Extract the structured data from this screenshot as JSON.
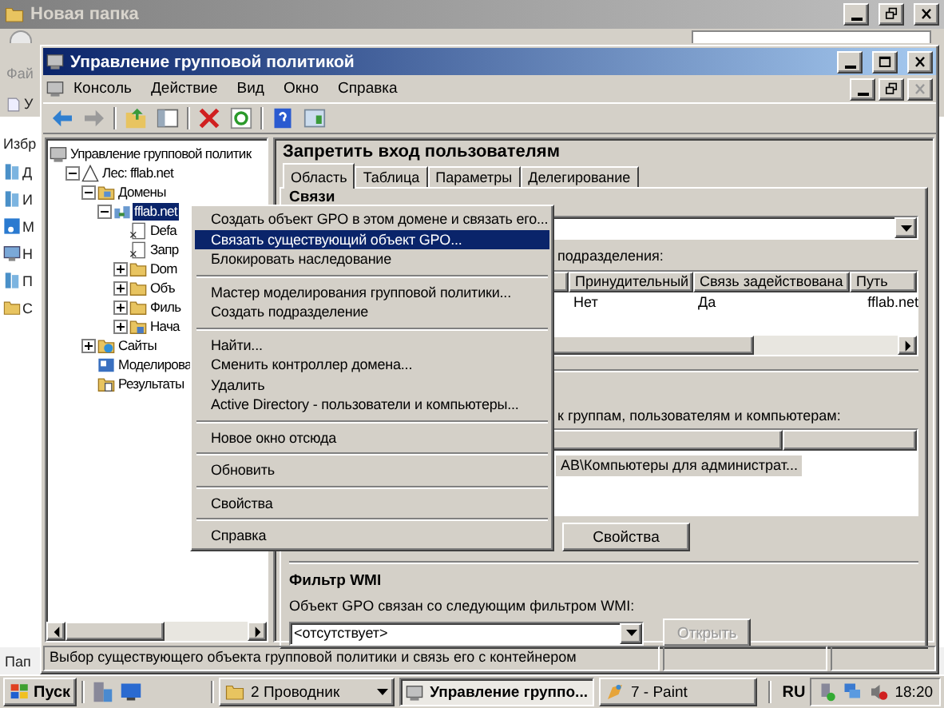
{
  "explorer": {
    "title": "Новая папка",
    "menu_label": "Фай",
    "toolbar_label": "У",
    "nav_heading": "Избр",
    "nav_items": [
      {
        "label": "Д",
        "kind": "library"
      },
      {
        "label": "И",
        "kind": "library"
      },
      {
        "label": "М",
        "kind": "music"
      },
      {
        "label": "Н",
        "kind": "computer"
      },
      {
        "label": "П",
        "kind": "library"
      },
      {
        "label": "С",
        "kind": "folder"
      }
    ],
    "status": "Пап"
  },
  "window": {
    "title": "Управление групповой политикой"
  },
  "menu_bar": [
    "Консоль",
    "Действие",
    "Вид",
    "Окно",
    "Справка"
  ],
  "tree": [
    {
      "label": "Управление групповой политик",
      "kind": "console",
      "selected": false,
      "children": [
        {
          "label": "Лес: fflab.net",
          "kind": "forest",
          "selected": false,
          "expanded": true,
          "children": [
            {
              "label": "Домены",
              "kind": "domains",
              "selected": false,
              "expanded": true,
              "children": [
                {
                  "label": "fflab.net",
                  "kind": "domain",
                  "selected": true,
                  "expanded": true,
                  "children": [
                    {
                      "label": "Defa",
                      "kind": "link",
                      "selected": false
                    },
                    {
                      "label": "Запр",
                      "kind": "link",
                      "selected": false
                    },
                    {
                      "label": "Dom",
                      "kind": "folder",
                      "selected": false,
                      "expanded": false
                    },
                    {
                      "label": "Объ",
                      "kind": "folder",
                      "selected": false,
                      "expanded": false
                    },
                    {
                      "label": "Филь",
                      "kind": "folder",
                      "selected": false,
                      "expanded": false
                    },
                    {
                      "label": "Нача",
                      "kind": "starter",
                      "selected": false,
                      "expanded": false
                    }
                  ]
                }
              ]
            },
            {
              "label": "Сайты",
              "kind": "sites",
              "selected": false,
              "expanded": false
            },
            {
              "label": "Моделирова",
              "kind": "modeling",
              "selected": false
            },
            {
              "label": "Результаты",
              "kind": "results",
              "selected": false
            }
          ]
        }
      ]
    }
  ],
  "details": {
    "title": "Запретить вход пользователям",
    "tabs": [
      {
        "label": "Область",
        "selected": true
      },
      {
        "label": "Таблица",
        "selected": false
      },
      {
        "label": "Параметры",
        "selected": false
      },
      {
        "label": "Делегирование",
        "selected": false
      }
    ],
    "links_heading": "Связи",
    "links_caption": "подразделения:",
    "links_table": {
      "columns": [
        "Принудительный",
        "Связь задействована",
        "Путь"
      ],
      "rows": [
        [
          "Нет",
          "Да",
          "fflab.net"
        ]
      ]
    },
    "security_caption": "к группам, пользователям и компьютерам:",
    "security_rows": [
      {
        "label": "AB\\Компьютеры для администрат...",
        "selected": true
      }
    ],
    "properties_button": "Свойства",
    "wmi": {
      "heading": "Фильтр WMI",
      "caption": "Объект GPO связан со следующим фильтром WMI:",
      "value": "<отсутствует>",
      "open_button": {
        "label": "Открыть",
        "disabled": true
      }
    }
  },
  "context_menu": [
    {
      "items": [
        {
          "label": "Создать объект GPO в этом домене и связать его...",
          "selected": false
        },
        {
          "label": "Связать существующий объект GPO...",
          "selected": true
        },
        {
          "label": "Блокировать наследование",
          "selected": false
        }
      ]
    },
    {
      "items": [
        {
          "label": "Мастер моделирования групповой политики...",
          "selected": false
        },
        {
          "label": "Создать подразделение",
          "selected": false
        }
      ]
    },
    {
      "items": [
        {
          "label": "Найти...",
          "selected": false
        },
        {
          "label": "Сменить контроллер домена...",
          "selected": false
        },
        {
          "label": "Удалить",
          "selected": false
        },
        {
          "label": "Active Directory - пользователи и компьютеры...",
          "selected": false
        }
      ]
    },
    {
      "items": [
        {
          "label": "Новое окно отсюда",
          "selected": false
        }
      ]
    },
    {
      "items": [
        {
          "label": "Обновить",
          "selected": false
        }
      ]
    },
    {
      "items": [
        {
          "label": "Свойства",
          "selected": false
        }
      ]
    },
    {
      "items": [
        {
          "label": "Справка",
          "selected": false
        }
      ]
    }
  ],
  "status_bar": "Выбор существующего объекта групповой политики и связь его с контейнером",
  "taskbar": {
    "start": "Пуск",
    "tasks": [
      {
        "label": "2 Проводник",
        "kind": "group",
        "selected": false
      },
      {
        "label": "Управление группо...",
        "kind": "console",
        "selected": true
      },
      {
        "label": "7 - Paint",
        "kind": "paint",
        "selected": false
      }
    ],
    "language": "RU",
    "clock": "18:20"
  }
}
